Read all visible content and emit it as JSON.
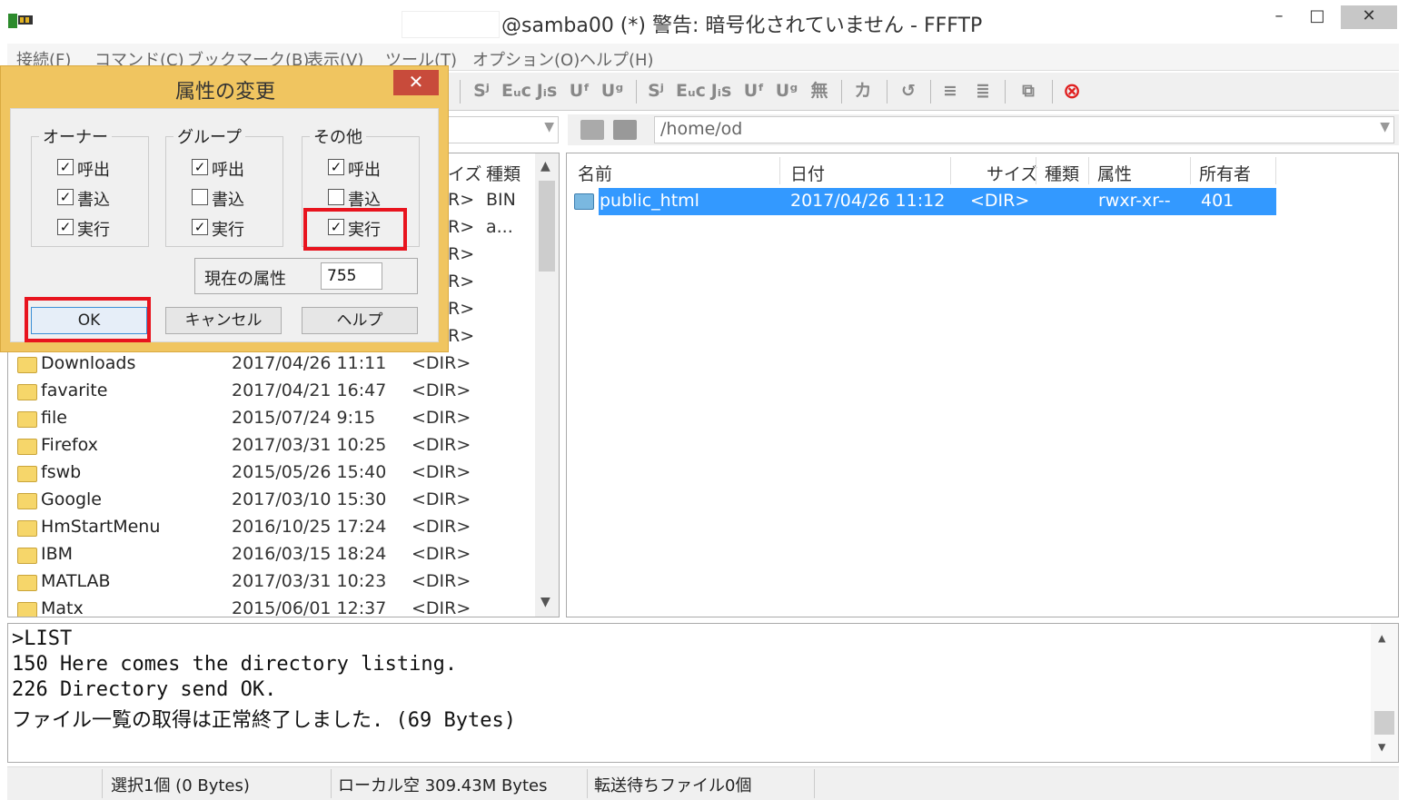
{
  "window": {
    "title": "@samba00 (*) 警告: 暗号化されていません - FFFTP",
    "controls": {
      "minimize": "–",
      "maximize": "□",
      "close": "✕"
    }
  },
  "menu": [
    "接続(F)",
    "コマンド(C)",
    "ブックマーク(B)",
    "表示(V)",
    "ツール(T)",
    "オプション(O)",
    "ヘルプ(H)"
  ],
  "toolbar": {
    "icons": [
      "Sʲ",
      "Eᵤc",
      "Jᵢs",
      "Uᶠ",
      "Uᵍ",
      "Sʲ",
      "Eᵤc",
      "Jᵢs",
      "Uᶠ",
      "Uᵍ",
      "無",
      "カ",
      "↺",
      "≡",
      "≣",
      "⧉",
      "⊗"
    ],
    "stop_color": "#e02020"
  },
  "remote_path": "/home/od",
  "left_pane": {
    "headers": {
      "size": "イズ",
      "type": "種類"
    },
    "hidden_rows": [
      {
        "size": "R>",
        "type": "BIN"
      },
      {
        "size": "R>",
        "type": "a..."
      },
      {
        "size": "R>",
        "type": ""
      },
      {
        "size": "R>",
        "type": ""
      },
      {
        "size": "R>",
        "type": ""
      },
      {
        "size": "R>",
        "type": ""
      }
    ],
    "rows": [
      {
        "name": "Downloads",
        "date": "2017/04/26 11:11",
        "size": "<DIR>"
      },
      {
        "name": "favarite",
        "date": "2017/04/21 16:47",
        "size": "<DIR>"
      },
      {
        "name": "file",
        "date": "2015/07/24  9:15",
        "size": "<DIR>"
      },
      {
        "name": "Firefox",
        "date": "2017/03/31 10:25",
        "size": "<DIR>"
      },
      {
        "name": "fswb",
        "date": "2015/05/26 15:40",
        "size": "<DIR>"
      },
      {
        "name": "Google",
        "date": "2017/03/10 15:30",
        "size": "<DIR>"
      },
      {
        "name": "HmStartMenu",
        "date": "2016/10/25 17:24",
        "size": "<DIR>"
      },
      {
        "name": "IBM",
        "date": "2016/03/15 18:24",
        "size": "<DIR>"
      },
      {
        "name": "MATLAB",
        "date": "2017/03/31 10:23",
        "size": "<DIR>"
      },
      {
        "name": "Matx",
        "date": "2015/06/01 12:37",
        "size": "<DIR>"
      }
    ]
  },
  "right_pane": {
    "headers": {
      "name": "名前",
      "date": "日付",
      "size": "サイズ",
      "type": "種類",
      "attr": "属性",
      "owner": "所有者"
    },
    "row": {
      "name": "public_html",
      "date": "2017/04/26 11:12",
      "size": "<DIR>",
      "attr": "rwxr-xr--",
      "owner": "401"
    }
  },
  "log": [
    ">LIST",
    "150 Here comes the directory listing.",
    "226 Directory send OK.",
    "ファイル一覧の取得は正常終了しました. (69 Bytes)"
  ],
  "status": {
    "selected": "選択1個 (0 Bytes)",
    "local_free": "ローカル空 309.43M Bytes",
    "queue": "転送待ちファイル0個"
  },
  "dialog": {
    "title": "属性の変更",
    "close": "✕",
    "groups": {
      "owner": {
        "title": "オーナー",
        "read": {
          "label": "呼出",
          "checked": true
        },
        "write": {
          "label": "書込",
          "checked": true
        },
        "exec": {
          "label": "実行",
          "checked": true
        }
      },
      "group": {
        "title": "グループ",
        "read": {
          "label": "呼出",
          "checked": true
        },
        "write": {
          "label": "書込",
          "checked": false
        },
        "exec": {
          "label": "実行",
          "checked": true
        }
      },
      "other": {
        "title": "その他",
        "read": {
          "label": "呼出",
          "checked": true
        },
        "write": {
          "label": "書込",
          "checked": false
        },
        "exec": {
          "label": "実行",
          "checked": true
        }
      }
    },
    "current_attr_label": "現在の属性",
    "current_attr_value": "755",
    "buttons": {
      "ok": "OK",
      "cancel": "キャンセル",
      "help": "ヘルプ"
    }
  },
  "highlight_color": "#e8141e"
}
